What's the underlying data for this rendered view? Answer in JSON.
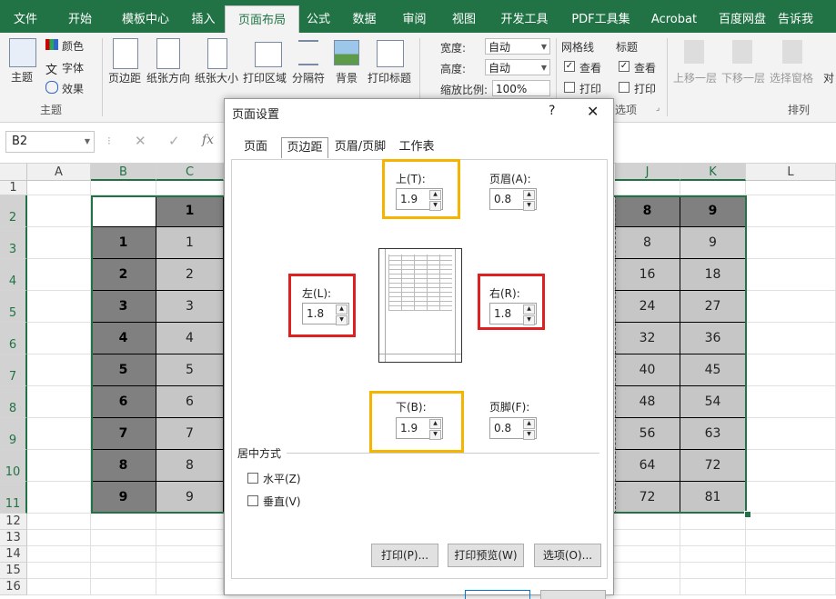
{
  "ribbon_tabs": [
    "文件",
    "开始",
    "模板中心",
    "插入",
    "页面布局",
    "公式",
    "数据",
    "审阅",
    "视图",
    "开发工具",
    "PDF工具集",
    "Acrobat",
    "百度网盘",
    "告诉我"
  ],
  "active_tab": "页面布局",
  "ribbon": {
    "theme_label": "主题",
    "color_label": "颜色",
    "font_label": "字体",
    "effect_label": "效果",
    "theme_group": "主题",
    "margins": "页边距",
    "orientation": "纸张方向",
    "size": "纸张大小",
    "print_area": "打印区域",
    "breaks": "分隔符",
    "background": "背景",
    "print_titles": "打印标题",
    "width_label": "宽度:",
    "width_value": "自动",
    "height_label": "高度:",
    "height_value": "自动",
    "scale_label": "缩放比例:",
    "scale_value": "100%",
    "gridlines": "网格线",
    "headings": "标题",
    "view1": "查看",
    "print1": "打印",
    "view2": "查看",
    "print2": "打印",
    "options_fragment": "选项",
    "bring_forward": "上移一层",
    "send_backward": "下移一层",
    "selection_pane": "选择窗格",
    "align_fragment": "对",
    "arrange_group": "排列"
  },
  "formula_bar": {
    "name_box": "B2",
    "fx": "fx"
  },
  "columns": [
    "A",
    "B",
    "C",
    "J",
    "K",
    "L"
  ],
  "rows": [
    "1",
    "2",
    "3",
    "4",
    "5",
    "6",
    "7",
    "8",
    "9",
    "10",
    "11",
    "12",
    "13",
    "14",
    "15",
    "16"
  ],
  "grid": {
    "header_row": {
      "C": "1",
      "J": "8",
      "K": "9"
    },
    "b_col": [
      "1",
      "2",
      "3",
      "4",
      "5",
      "6",
      "7",
      "8",
      "9"
    ],
    "c_col": [
      "1",
      "2",
      "3",
      "4",
      "5",
      "6",
      "7",
      "8",
      "9"
    ],
    "j_col": [
      "8",
      "16",
      "24",
      "32",
      "40",
      "48",
      "56",
      "64",
      "72"
    ],
    "k_col": [
      "9",
      "18",
      "27",
      "36",
      "45",
      "54",
      "63",
      "72",
      "81"
    ]
  },
  "dialog": {
    "title": "页面设置",
    "help": "?",
    "close": "✕",
    "tabs": [
      "页面",
      "页边距",
      "页眉/页脚",
      "工作表"
    ],
    "active_tab": "页边距",
    "top_label": "上(T):",
    "top_value": "1.9",
    "header_label": "页眉(A):",
    "header_value": "0.8",
    "left_label": "左(L):",
    "left_value": "1.8",
    "right_label": "右(R):",
    "right_value": "1.8",
    "bottom_label": "下(B):",
    "bottom_value": "1.9",
    "footer_label": "页脚(F):",
    "footer_value": "0.8",
    "center_section": "居中方式",
    "horizontal": "水平(Z)",
    "vertical": "垂直(V)",
    "print_btn": "打印(P)...",
    "preview_btn": "打印预览(W)",
    "options_btn": "选项(O)..."
  },
  "colors": {
    "excel_green": "#217346",
    "highlight_orange": "#f5b400",
    "highlight_red": "#e02020",
    "dark_cell": "#808080",
    "light_cell": "#c6c6c6"
  }
}
